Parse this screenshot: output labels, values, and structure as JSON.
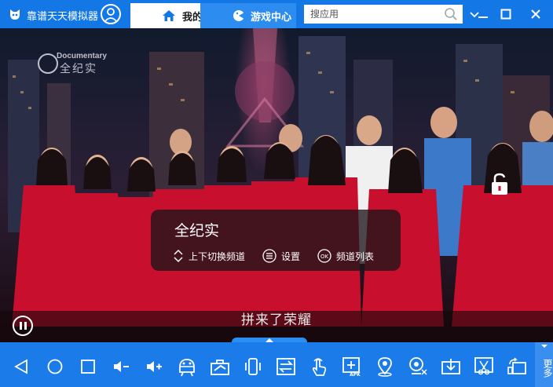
{
  "window": {
    "title": "靠谱天天模拟器",
    "tabs": [
      {
        "label": "我的",
        "icon": "home-icon"
      },
      {
        "label": "游戏中心",
        "icon": "gamepad-icon"
      }
    ],
    "search": {
      "placeholder": "搜应用"
    }
  },
  "video": {
    "watermark": {
      "en": "Documentary",
      "cn": "全纪实"
    },
    "subtitle": "拼来了荣耀"
  },
  "channel_overlay": {
    "title": "全纪实",
    "options": [
      {
        "label": "上下切换频道",
        "icon": "up-down-arrows-icon"
      },
      {
        "label": "设置",
        "icon": "menu-list-icon"
      },
      {
        "label": "频道列表",
        "icon": "ok-icon"
      }
    ]
  },
  "toolbar": {
    "more_label": "更多",
    "accent": "#1b7be8"
  },
  "colors": {
    "titlebar": "#1477e6",
    "dress_red": "#c8102e"
  }
}
